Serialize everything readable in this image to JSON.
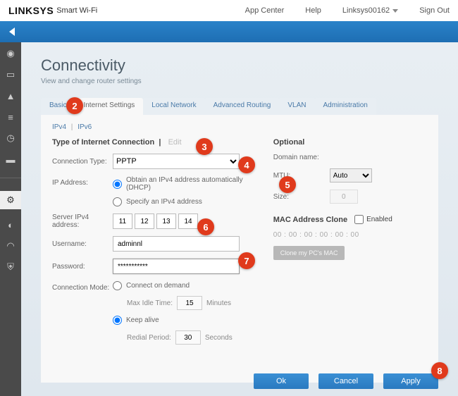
{
  "header": {
    "brand": "LINKSYS",
    "brand_sub": "Smart Wi-Fi",
    "app_center": "App Center",
    "help": "Help",
    "device": "Linksys00162",
    "signout": "Sign Out"
  },
  "page": {
    "title": "Connectivity",
    "subtitle": "View and change router settings"
  },
  "tabs": {
    "basic": "Basic",
    "internet": "Internet Settings",
    "local": "Local Network",
    "routing": "Advanced Routing",
    "vlan": "VLAN",
    "admin": "Administration"
  },
  "ipv": {
    "v4": "IPv4",
    "v6": "IPv6"
  },
  "section": {
    "main_title": "Type of Internet Connection",
    "edit": "Edit",
    "optional": "Optional"
  },
  "form": {
    "conn_type_label": "Connection Type:",
    "conn_type_value": "PPTP",
    "ip_address_label": "IP Address:",
    "radio_dhcp": "Obtain an IPv4 address automatically (DHCP)",
    "radio_specify": "Specify an IPv4 address",
    "server_ip_label": "Server IPv4 address:",
    "server_ip": [
      "11",
      "12",
      "13",
      "14"
    ],
    "username_label": "Username:",
    "username_value": "adminnl",
    "password_label": "Password:",
    "password_value": "***********",
    "conn_mode_label": "Connection Mode:",
    "demand": "Connect on demand",
    "max_idle_label": "Max Idle Time:",
    "max_idle_value": "15",
    "minutes": "Minutes",
    "keep_alive": "Keep alive",
    "redial_label": "Redial Period:",
    "redial_value": "30",
    "seconds": "Seconds"
  },
  "optional": {
    "domain_label": "Domain name:",
    "mtu_label": "MTU:",
    "mtu_value": "Auto",
    "size_label": "Size:",
    "size_value": "0",
    "mac_title": "MAC Address Clone",
    "mac_enabled": "Enabled",
    "mac_addr": "00 : 00 : 00 : 00 : 00 : 00",
    "clone_btn": "Clone my PC's MAC"
  },
  "footer": {
    "ok": "Ok",
    "cancel": "Cancel",
    "apply": "Apply"
  },
  "callouts": {
    "c2": "2",
    "c3": "3",
    "c4": "4",
    "c5": "5",
    "c6": "6",
    "c7": "7",
    "c8": "8"
  }
}
